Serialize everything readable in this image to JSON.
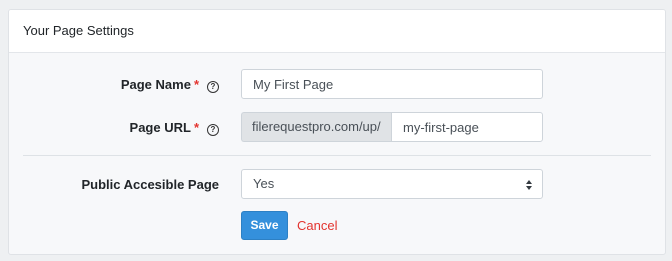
{
  "card": {
    "title": "Your Page Settings"
  },
  "form": {
    "page_name": {
      "label": "Page Name",
      "required_mark": "*",
      "help_icon": "question-circle-icon",
      "value": "My First Page"
    },
    "page_url": {
      "label": "Page URL",
      "required_mark": "*",
      "help_icon": "question-circle-icon",
      "prefix": "filerequestpro.com/up/",
      "value": "my-first-page"
    },
    "public_page": {
      "label": "Public Accesible Page",
      "selected": "Yes",
      "arrow_icon": "select-arrows-icon"
    }
  },
  "actions": {
    "save_label": "Save",
    "cancel_label": "Cancel"
  },
  "colors": {
    "primary": "#3490dc",
    "danger": "#e3342f",
    "card_header_bg": "#ffffff",
    "card_body_bg": "#f7f8fa",
    "addon_bg": "#e0e3e6"
  }
}
